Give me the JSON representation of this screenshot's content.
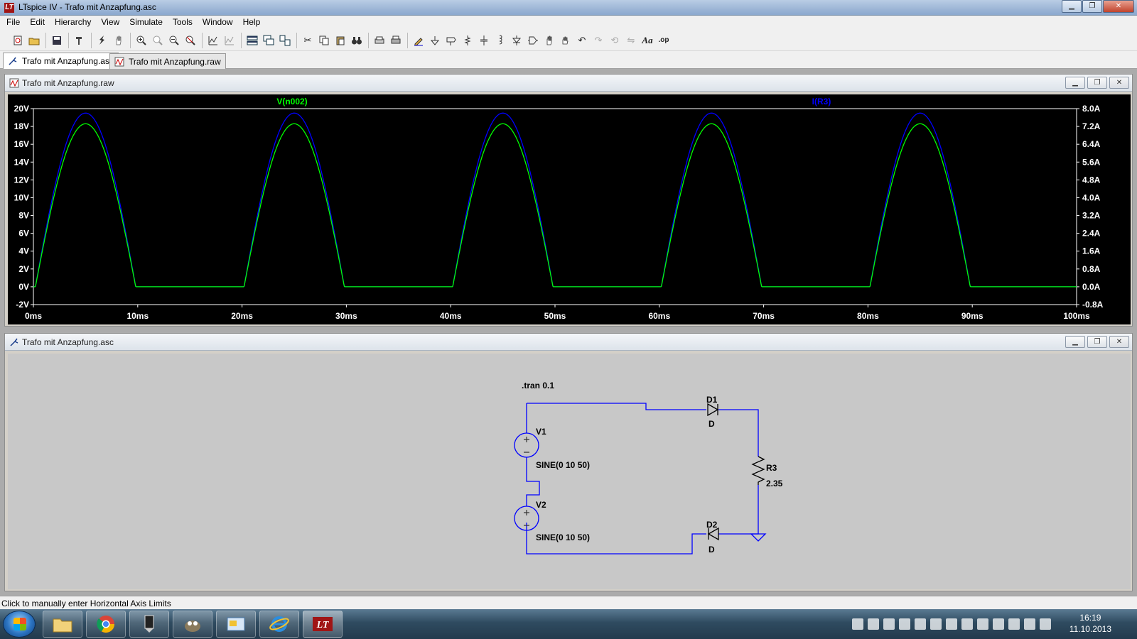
{
  "window": {
    "title": "LTspice IV - Trafo mit Anzapfung.asc",
    "minimize": "▁",
    "restore": "❐",
    "close": "✕"
  },
  "menu": [
    "File",
    "Edit",
    "Hierarchy",
    "View",
    "Simulate",
    "Tools",
    "Window",
    "Help"
  ],
  "tabs": [
    {
      "label": "Trafo mit Anzapfung.asc",
      "active": true
    },
    {
      "label": "Trafo mit Anzapfung.raw",
      "active": false
    }
  ],
  "waveform_window": {
    "title": "Trafo mit Anzapfung.raw",
    "trace_labels": [
      {
        "name": "V(n002)",
        "color": "#00ff00"
      },
      {
        "name": "I(R3)",
        "color": "#0000ff"
      }
    ]
  },
  "chart_data": {
    "type": "line",
    "x_tick_labels": [
      "0ms",
      "10ms",
      "20ms",
      "30ms",
      "40ms",
      "50ms",
      "60ms",
      "70ms",
      "80ms",
      "90ms",
      "100ms"
    ],
    "left_tick_labels": [
      "20V",
      "18V",
      "16V",
      "14V",
      "12V",
      "10V",
      "8V",
      "6V",
      "4V",
      "2V",
      "0V",
      "-2V"
    ],
    "right_tick_labels": [
      "8.0A",
      "7.2A",
      "6.4A",
      "5.6A",
      "4.8A",
      "4.0A",
      "3.2A",
      "2.4A",
      "1.6A",
      "0.8A",
      "0.0A",
      "-0.8A"
    ],
    "xlim": [
      0,
      100
    ],
    "ylim_left": [
      -2,
      20
    ],
    "ylim_right": [
      -0.8,
      8.0
    ],
    "series": [
      {
        "name": "V(n002)",
        "color": "#00ff00",
        "peak_v": 18.3,
        "period_ms": 20,
        "frequency_hz": 50,
        "conduction": "half-wave"
      },
      {
        "name": "I(R3)",
        "color": "#0000ff",
        "peak_a": 7.8,
        "period_ms": 20,
        "frequency_hz": 50,
        "conduction": "half-wave"
      }
    ],
    "background": "#000000"
  },
  "schematic_window": {
    "title": "Trafo mit Anzapfung.asc",
    "directive": ".tran 0.1",
    "components": {
      "V1": {
        "name": "V1",
        "value": "SINE(0 10 50)"
      },
      "V2": {
        "name": "V2",
        "value": "SINE(0 10 50)"
      },
      "D1": {
        "name": "D1",
        "model": "D"
      },
      "D2": {
        "name": "D2",
        "model": "D"
      },
      "R3": {
        "name": "R3",
        "value": "2.35"
      }
    },
    "wire_color": "#0000ff"
  },
  "status": "Click to manually enter Horizontal Axis Limits",
  "taskbar": {
    "time": "16:19",
    "date": "11.10.2013"
  }
}
